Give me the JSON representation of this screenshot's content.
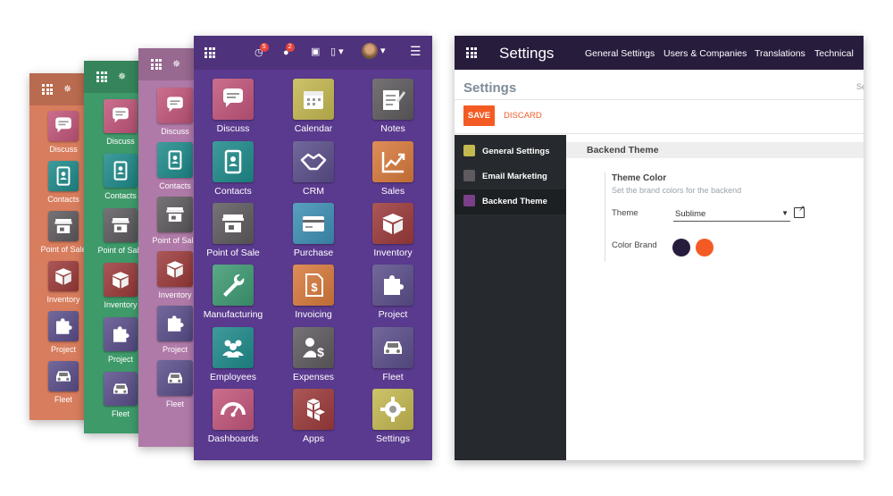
{
  "panels": [
    {
      "id": "p1",
      "bg": "#d87d5d",
      "apps": [
        {
          "label": "Discuss",
          "icon": "chat-bubble-icon",
          "color": "#c2557a"
        },
        {
          "label": "Contacts",
          "icon": "address-book-icon",
          "color": "#1e8a8a"
        },
        {
          "label": "Point of Sale",
          "icon": "store-icon",
          "color": "#5e5a5e"
        },
        {
          "label": "Inventory",
          "icon": "box-icon",
          "color": "#9c3a3a"
        },
        {
          "label": "Project",
          "icon": "puzzle-icon",
          "color": "#5a4e8a"
        },
        {
          "label": "Fleet",
          "icon": "car-icon",
          "color": "#5a4e8a"
        }
      ]
    },
    {
      "id": "p2",
      "bg": "#3f9a6a",
      "apps": [
        {
          "label": "Discuss",
          "icon": "chat-bubble-icon",
          "color": "#c2557a"
        },
        {
          "label": "Contacts",
          "icon": "address-book-icon",
          "color": "#1e8a8a"
        },
        {
          "label": "Point of Sale",
          "icon": "store-icon",
          "color": "#5e5a5e"
        },
        {
          "label": "Inventory",
          "icon": "box-icon",
          "color": "#9c3a3a"
        },
        {
          "label": "Project",
          "icon": "puzzle-icon",
          "color": "#5a4e8a"
        },
        {
          "label": "Fleet",
          "icon": "car-icon",
          "color": "#5a4e8a"
        }
      ]
    },
    {
      "id": "p3",
      "bg": "#b07aa8",
      "apps": [
        {
          "label": "Discuss",
          "icon": "chat-bubble-icon",
          "color": "#c2557a"
        },
        {
          "label": "Contacts",
          "icon": "address-book-icon",
          "color": "#1e8a8a"
        },
        {
          "label": "Point of Sale",
          "icon": "store-icon",
          "color": "#5e5a5e"
        },
        {
          "label": "Inventory",
          "icon": "box-icon",
          "color": "#9c3a3a"
        },
        {
          "label": "Project",
          "icon": "puzzle-icon",
          "color": "#5a4e8a"
        },
        {
          "label": "Fleet",
          "icon": "car-icon",
          "color": "#5a4e8a"
        }
      ]
    }
  ],
  "main_panel": {
    "bg": "#5a3a8e",
    "topbar": {
      "activity_count": "5",
      "messages_count": "2"
    },
    "apps": [
      {
        "label": "Discuss",
        "icon": "chat-bubble-icon",
        "color": "#c2557a"
      },
      {
        "label": "Calendar",
        "icon": "calendar-icon",
        "color": "#c4b850"
      },
      {
        "label": "Notes",
        "icon": "notes-icon",
        "color": "#5e5a5e"
      },
      {
        "label": "Contacts",
        "icon": "address-book-icon",
        "color": "#1e8a8a"
      },
      {
        "label": "CRM",
        "icon": "handshake-icon",
        "color": "#5a4e8a"
      },
      {
        "label": "Sales",
        "icon": "trend-chart-icon",
        "color": "#d87a3c"
      },
      {
        "label": "Point of Sale",
        "icon": "store-icon",
        "color": "#5e5a5e"
      },
      {
        "label": "Purchase",
        "icon": "credit-card-icon",
        "color": "#3d8fb5"
      },
      {
        "label": "Inventory",
        "icon": "box-icon",
        "color": "#9c3a3a"
      },
      {
        "label": "Manufacturing",
        "icon": "wrench-icon",
        "color": "#3d9a72"
      },
      {
        "label": "Invoicing",
        "icon": "invoice-icon",
        "color": "#d87a3c"
      },
      {
        "label": "Project",
        "icon": "puzzle-icon",
        "color": "#5a4e8a"
      },
      {
        "label": "Employees",
        "icon": "people-icon",
        "color": "#1e8a8a"
      },
      {
        "label": "Expenses",
        "icon": "expense-icon",
        "color": "#5e5a5e"
      },
      {
        "label": "Fleet",
        "icon": "car-icon",
        "color": "#5a4e8a"
      },
      {
        "label": "Dashboards",
        "icon": "gauge-icon",
        "color": "#c2557a"
      },
      {
        "label": "Apps",
        "icon": "cubes-icon",
        "color": "#9c3a3a"
      },
      {
        "label": "Settings",
        "icon": "gear-icon",
        "color": "#c4b850"
      }
    ]
  },
  "settings": {
    "nav": {
      "title": "Settings",
      "menu": [
        "General Settings",
        "Users & Companies",
        "Translations",
        "Technical"
      ]
    },
    "page_title": "Settings",
    "search_hint": "Se",
    "save_label": "SAVE",
    "discard_label": "DISCARD",
    "sidebar": [
      {
        "label": "General Settings",
        "color": "#c4b850"
      },
      {
        "label": "Email Marketing",
        "color": "#5e5a5e"
      },
      {
        "label": "Backend Theme",
        "color": "#7b3f8a",
        "active": true
      }
    ],
    "section_title": "Backend Theme",
    "theme_color": {
      "title": "Theme Color",
      "description": "Set the brand colors for the backend"
    },
    "theme_label": "Theme",
    "theme_value": "Sublime",
    "color_brand_label": "Color Brand",
    "brand_colors": [
      "#281c3d",
      "#f45b24"
    ]
  }
}
